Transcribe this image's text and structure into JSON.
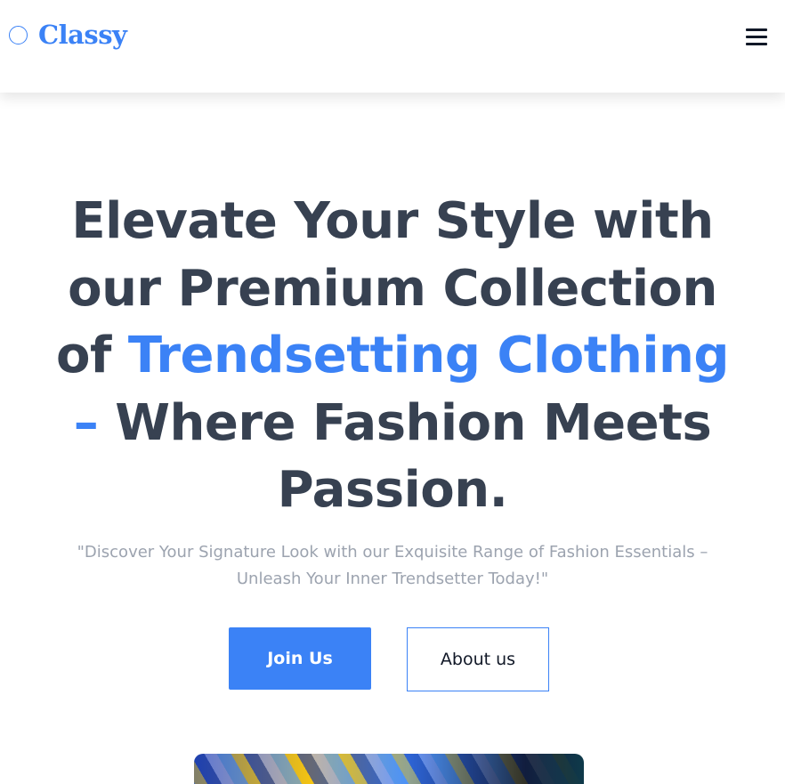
{
  "header": {
    "logo_text": "Classy",
    "logo_icon": "circle-icon",
    "menu_icon": "hamburger-menu-icon"
  },
  "hero": {
    "title_part1": "Elevate Your Style with our Premium Collection of ",
    "title_accent": "Trendsetting Clothing –",
    "title_part2": " Where Fashion Meets Passion.",
    "subtitle": "\"Discover Your Signature Look with our Exquisite Range of Fashion Essentials – Unleash Your Inner Trendsetter Today!\"",
    "primary_button": "Join Us",
    "secondary_button": "About us"
  },
  "colors": {
    "accent": "#3b82f6",
    "heading": "#374151",
    "muted": "#9ca3af"
  }
}
